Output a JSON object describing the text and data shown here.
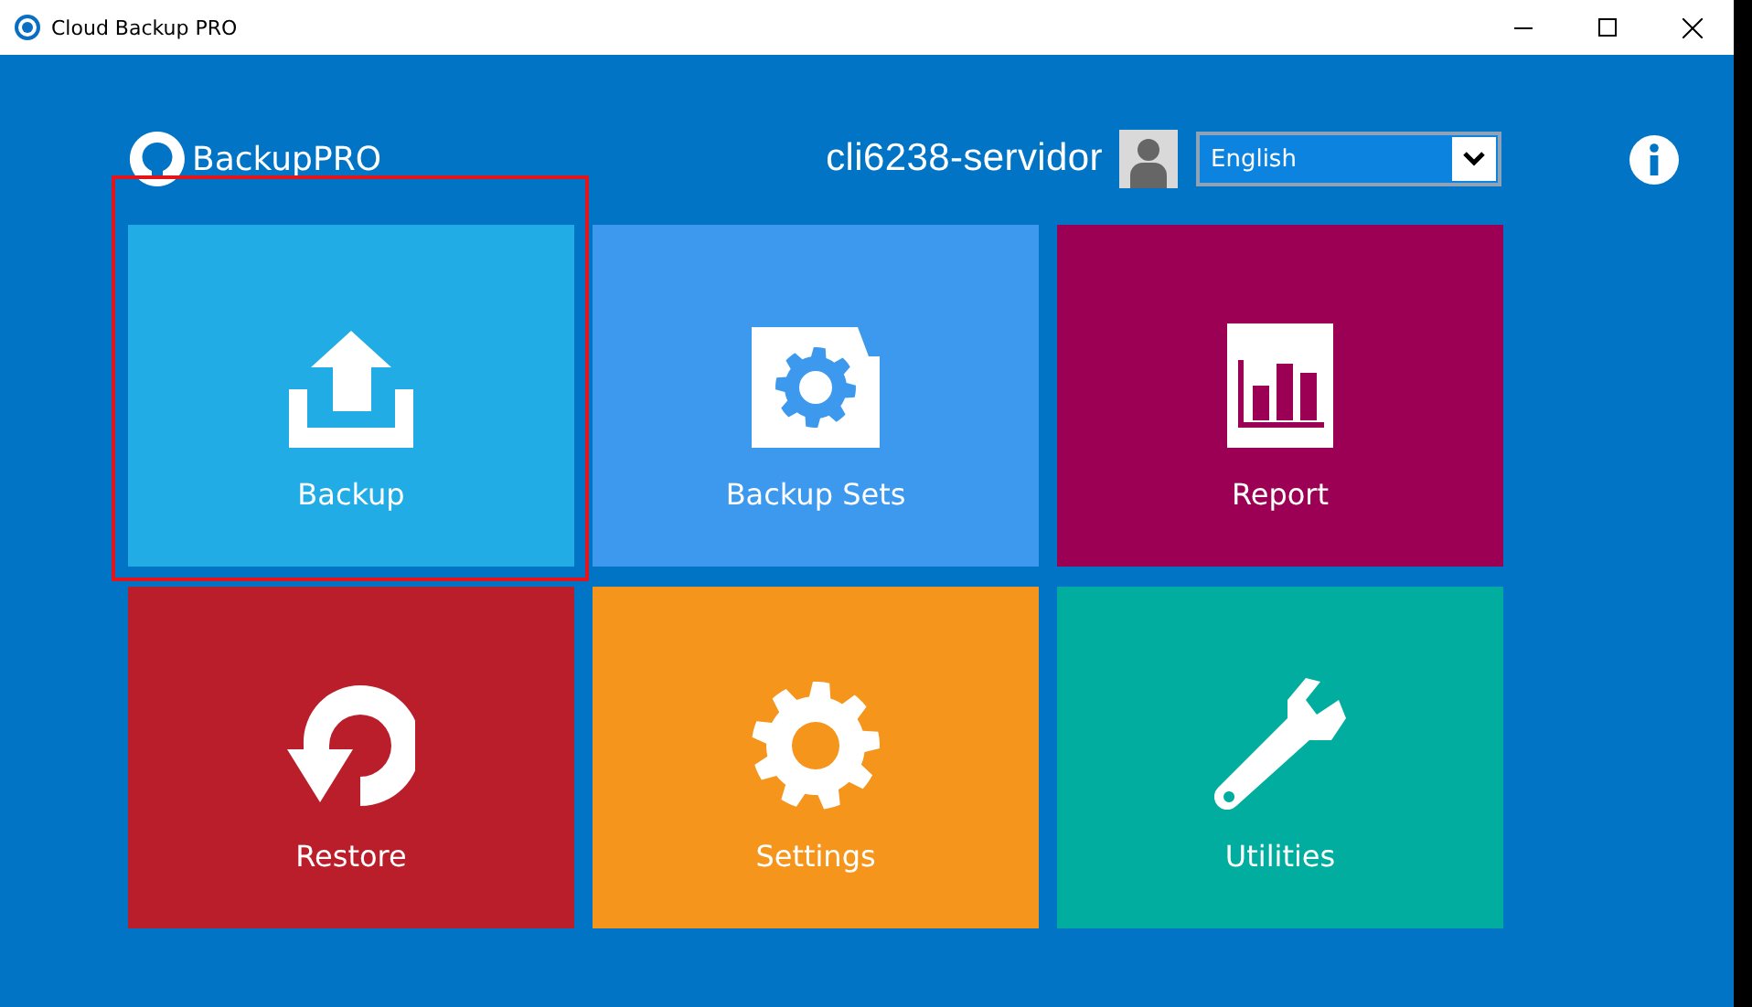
{
  "window": {
    "title": "Cloud Backup PRO"
  },
  "header": {
    "logo": "BackupPRO",
    "user": "cli6238-servidor",
    "language": "English"
  },
  "tiles": [
    {
      "label": "Backup",
      "kind": "upload",
      "color": "#22ace6",
      "selected": true
    },
    {
      "label": "Backup Sets",
      "kind": "folder-gear",
      "color": "#3d99ee",
      "selected": false
    },
    {
      "label": "Report",
      "kind": "chart",
      "color": "#9b0054",
      "selected": false
    },
    {
      "label": "Restore",
      "kind": "restore",
      "color": "#bb1e2b",
      "selected": false
    },
    {
      "label": "Settings",
      "kind": "gear",
      "color": "#f6951b",
      "selected": false
    },
    {
      "label": "Utilities",
      "kind": "wrench",
      "color": "#00ad9e",
      "selected": false
    }
  ]
}
